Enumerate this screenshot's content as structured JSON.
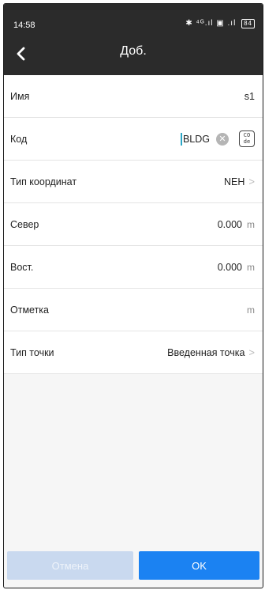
{
  "status_bar": {
    "time": "14:58",
    "icons": "✱ ⁴ᴳ.ıl ▣ .ıl",
    "battery": "84"
  },
  "nav": {
    "back_icon": "chevron-left",
    "title": "Доб."
  },
  "fields": {
    "name": {
      "label": "Имя",
      "value": "s1"
    },
    "code": {
      "label": "Код",
      "value": "BLDG",
      "clear_icon": "clear-circle",
      "code_icon_text": "CO de"
    },
    "coord_type": {
      "label": "Тип координат",
      "value": "NEH"
    },
    "north": {
      "label": "Север",
      "value": "0.000",
      "unit": "m"
    },
    "east": {
      "label": "Вост.",
      "value": "0.000",
      "unit": "m"
    },
    "elevation": {
      "label": "Отметка",
      "value": "",
      "unit": "m"
    },
    "point_type": {
      "label": "Тип точки",
      "value": "Введенная точка"
    }
  },
  "actions": {
    "cancel_label": "Отмена",
    "ok_label": "OK"
  },
  "colors": {
    "header": "#2b2b2b",
    "ok_button": "#1b82f2",
    "cancel_button_disabled": "#c9d9ef",
    "cursor": "#2aa5c5"
  }
}
